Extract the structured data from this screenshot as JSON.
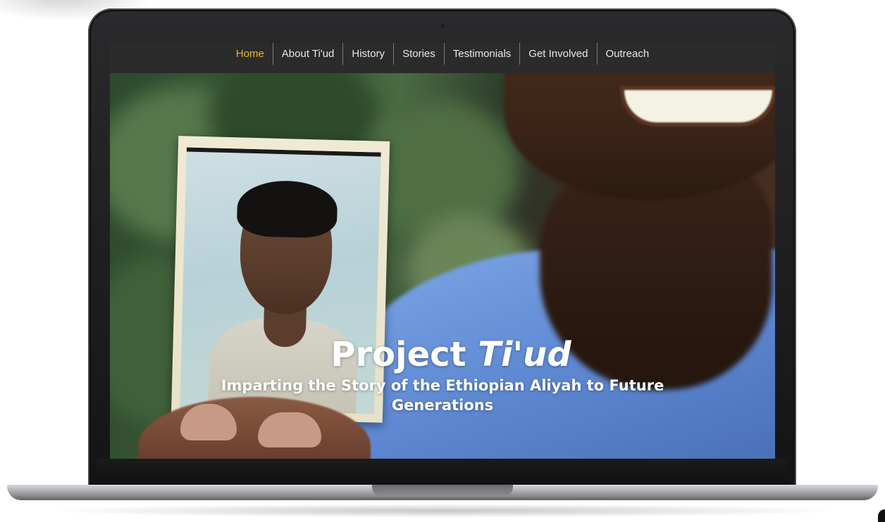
{
  "nav": {
    "items": [
      {
        "label": "Home",
        "active": true
      },
      {
        "label": "About Ti'ud",
        "active": false
      },
      {
        "label": "History",
        "active": false
      },
      {
        "label": "Stories",
        "active": false
      },
      {
        "label": "Testimonials",
        "active": false
      },
      {
        "label": "Get Involved",
        "active": false
      },
      {
        "label": "Outreach",
        "active": false
      }
    ]
  },
  "hero": {
    "title_main": "Project",
    "title_em": "Ti'ud",
    "subtitle": "Imparting the Story of the Ethiopian Aliyah to Future Generations"
  },
  "colors": {
    "nav_background": "#2b2b2b",
    "nav_active": "#f1b52b",
    "nav_text": "#e8e8e8",
    "hero_text": "#ffffff"
  }
}
